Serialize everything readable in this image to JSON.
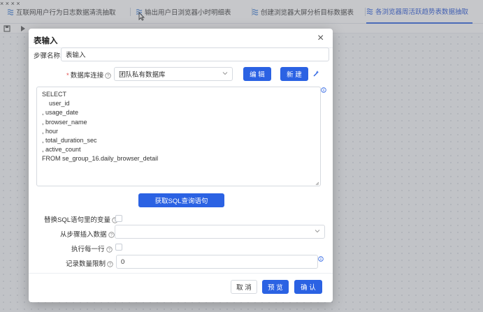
{
  "colors": {
    "primary": "#2b62e3",
    "active_tab_text": "#1e4fd6",
    "required": "#e34d4d"
  },
  "tabs": [
    {
      "label": "互联网用户行为日志数据清洗抽取",
      "icon": "stream-icon",
      "active": false
    },
    {
      "label": "输出用户日浏览器小时明细表",
      "icon": "stream-icon",
      "active": false
    },
    {
      "label": "创建浏览器大屏分析目标数据表",
      "icon": "stream-icon",
      "active": false
    },
    {
      "label": "各浏览器周活跃趋势表数据抽取",
      "icon": "stream-icon",
      "active": true
    }
  ],
  "modal": {
    "title": "表输入",
    "step_name": {
      "label": "步骤名称:",
      "value": "表输入"
    },
    "db_connection": {
      "label": "数据库连接",
      "value": "团队私有数据库",
      "edit_label": "编 辑",
      "new_label": "新 建"
    },
    "sql_lines": [
      "SELECT",
      "    user_id",
      ", usage_date",
      ", browser_name",
      ", hour",
      ", total_duration_sec",
      ", active_count",
      "FROM se_group_16.daily_browser_detail"
    ],
    "get_sql_label": "获取SQL查询语句",
    "replace_vars": {
      "label": "替换SQL语句里的变量",
      "checked": false
    },
    "insert_from_step": {
      "label": "从步骤插入数据",
      "value": ""
    },
    "execute_each_row": {
      "label": "执行每一行",
      "checked": false
    },
    "record_limit": {
      "label": "记录数量限制",
      "value": "0"
    },
    "cancel_label": "取 消",
    "preview_label": "预 览",
    "confirm_label": "确 认"
  }
}
